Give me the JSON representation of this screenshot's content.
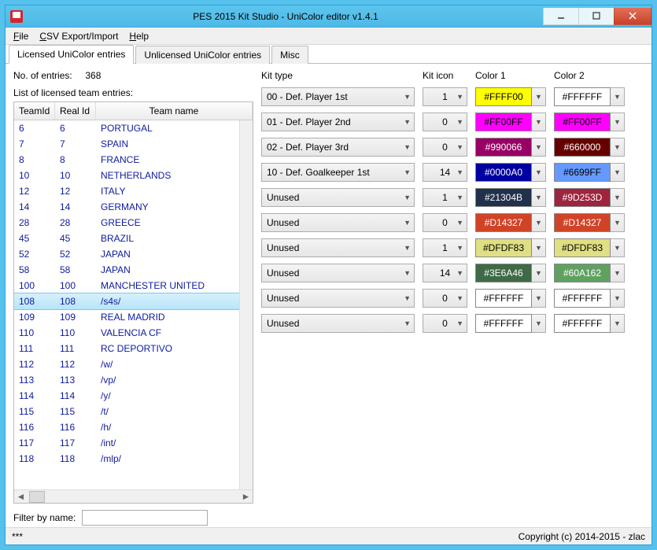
{
  "window": {
    "title": "PES 2015 Kit Studio - UniColor editor v1.4.1"
  },
  "menu": {
    "file": "File",
    "csv": "CSV Export/Import",
    "help": "Help"
  },
  "tabs": {
    "t1": "Licensed UniColor entries",
    "t2": "Unlicensed UniColor entries",
    "t3": "Misc"
  },
  "left": {
    "entries_label": "No. of entries:",
    "entries_count": "368",
    "list_label": "List of licensed team entries:",
    "cols": {
      "c1": "TeamId",
      "c2": "Real Id",
      "c3": "Team name"
    },
    "rows": [
      {
        "tid": "6",
        "rid": "6",
        "name": "PORTUGAL"
      },
      {
        "tid": "7",
        "rid": "7",
        "name": "SPAIN"
      },
      {
        "tid": "8",
        "rid": "8",
        "name": "FRANCE"
      },
      {
        "tid": "10",
        "rid": "10",
        "name": "NETHERLANDS"
      },
      {
        "tid": "12",
        "rid": "12",
        "name": "ITALY"
      },
      {
        "tid": "14",
        "rid": "14",
        "name": "GERMANY"
      },
      {
        "tid": "28",
        "rid": "28",
        "name": "GREECE"
      },
      {
        "tid": "45",
        "rid": "45",
        "name": "BRAZIL"
      },
      {
        "tid": "52",
        "rid": "52",
        "name": "JAPAN"
      },
      {
        "tid": "58",
        "rid": "58",
        "name": "JAPAN"
      },
      {
        "tid": "100",
        "rid": "100",
        "name": "MANCHESTER UNITED"
      },
      {
        "tid": "108",
        "rid": "108",
        "name": "/s4s/",
        "sel": true
      },
      {
        "tid": "109",
        "rid": "109",
        "name": "REAL MADRID"
      },
      {
        "tid": "110",
        "rid": "110",
        "name": "VALENCIA CF"
      },
      {
        "tid": "111",
        "rid": "111",
        "name": "RC DEPORTIVO"
      },
      {
        "tid": "112",
        "rid": "112",
        "name": "/w/"
      },
      {
        "tid": "113",
        "rid": "113",
        "name": "/vp/"
      },
      {
        "tid": "114",
        "rid": "114",
        "name": "/y/"
      },
      {
        "tid": "115",
        "rid": "115",
        "name": "/t/"
      },
      {
        "tid": "116",
        "rid": "116",
        "name": "/h/"
      },
      {
        "tid": "117",
        "rid": "117",
        "name": "/int/"
      },
      {
        "tid": "118",
        "rid": "118",
        "name": "/mlp/"
      }
    ],
    "filter_label": "Filter by name:"
  },
  "right": {
    "head": {
      "kittype": "Kit type",
      "kiticon": "Kit icon",
      "c1": "Color 1",
      "c2": "Color 2"
    },
    "rows": [
      {
        "type": "00 - Def. Player 1st",
        "icon": "1",
        "c1": "#FFFF00",
        "b1": "#FFFF00",
        "t1": "#000",
        "c2": "#FFFFFF",
        "b2": "#FFFFFF",
        "t2": "#000"
      },
      {
        "type": "01 - Def. Player 2nd",
        "icon": "0",
        "c1": "#FF00FF",
        "b1": "#FF00FF",
        "t1": "#000",
        "c2": "#FF00FF",
        "b2": "#FF00FF",
        "t2": "#000"
      },
      {
        "type": "02 - Def. Player 3rd",
        "icon": "0",
        "c1": "#990066",
        "b1": "#990066",
        "t1": "#fff",
        "c2": "#660000",
        "b2": "#660000",
        "t2": "#fff"
      },
      {
        "type": "10 - Def. Goalkeeper 1st",
        "icon": "14",
        "c1": "#0000A0",
        "b1": "#0000A0",
        "t1": "#fff",
        "c2": "#6699FF",
        "b2": "#6699FF",
        "t2": "#000"
      },
      {
        "type": "Unused",
        "icon": "1",
        "c1": "#21304B",
        "b1": "#21304B",
        "t1": "#fff",
        "c2": "#9D253D",
        "b2": "#9D253D",
        "t2": "#fff"
      },
      {
        "type": "Unused",
        "icon": "0",
        "c1": "#D14327",
        "b1": "#D14327",
        "t1": "#fff",
        "c2": "#D14327",
        "b2": "#D14327",
        "t2": "#fff"
      },
      {
        "type": "Unused",
        "icon": "1",
        "c1": "#DFDF83",
        "b1": "#DFDF83",
        "t1": "#000",
        "c2": "#DFDF83",
        "b2": "#DFDF83",
        "t2": "#000"
      },
      {
        "type": "Unused",
        "icon": "14",
        "c1": "#3E6A46",
        "b1": "#3E6A46",
        "t1": "#fff",
        "c2": "#60A162",
        "b2": "#60A162",
        "t2": "#fff"
      },
      {
        "type": "Unused",
        "icon": "0",
        "c1": "#FFFFFF",
        "b1": "#FFFFFF",
        "t1": "#000",
        "c2": "#FFFFFF",
        "b2": "#FFFFFF",
        "t2": "#000"
      },
      {
        "type": "Unused",
        "icon": "0",
        "c1": "#FFFFFF",
        "b1": "#FFFFFF",
        "t1": "#000",
        "c2": "#FFFFFF",
        "b2": "#FFFFFF",
        "t2": "#000"
      }
    ]
  },
  "status": {
    "left": "***",
    "right": "Copyright (c) 2014-2015 - zlac"
  }
}
